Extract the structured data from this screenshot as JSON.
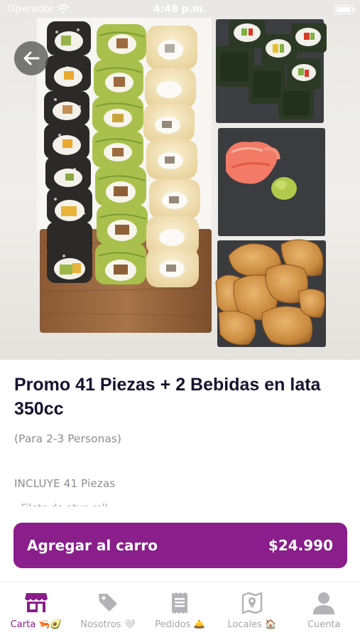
{
  "status_bar": {
    "carrier": "Operador",
    "time": "4:48 p.m."
  },
  "product": {
    "title": "Promo 41 Piezas + 2 Bebidas en lata 350cc",
    "subtitle": "(Para 2-3 Personas)",
    "includes": "INCLUYE 41  Piezas",
    "more_text": "- Filete de atun roll"
  },
  "cart": {
    "label": "Agregar al carro",
    "price": "$24.990"
  },
  "tabs": [
    {
      "label": "Carta 🦐🥑",
      "icon": "store-icon",
      "active": true
    },
    {
      "label": "Nosotros 🤍",
      "icon": "tag-icon",
      "active": false
    },
    {
      "label": "Pedidos 🛎️",
      "icon": "receipt-icon",
      "active": false
    },
    {
      "label": "Locales 🏠",
      "icon": "map-icon",
      "active": false
    },
    {
      "label": "Cuenta",
      "icon": "user-icon",
      "active": false
    }
  ],
  "colors": {
    "accent": "#8a1e8a",
    "inactive": "#a6a6ab",
    "title": "#16122e"
  }
}
